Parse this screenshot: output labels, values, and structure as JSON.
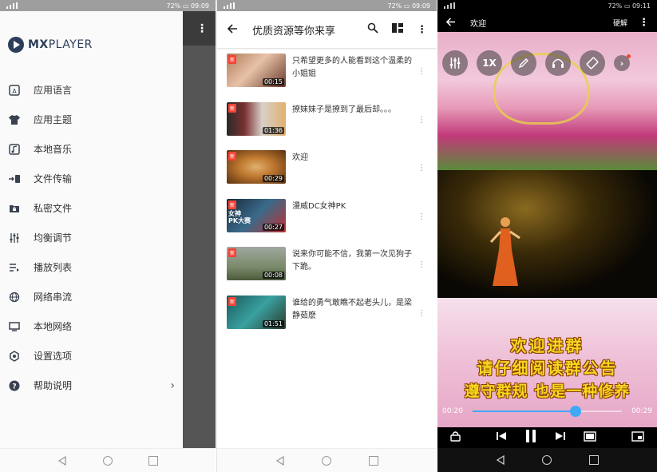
{
  "status": {
    "screen1": {
      "battery": "72%",
      "time": "09:09"
    },
    "screen2": {
      "battery": "72%",
      "time": "09:09"
    },
    "screen3": {
      "battery": "72%",
      "time": "09:11"
    }
  },
  "drawer": {
    "logo_bold": "MX",
    "logo_light": "PLAYER",
    "items": [
      {
        "label": "应用语言",
        "icon": "language-icon"
      },
      {
        "label": "应用主题",
        "icon": "shirt-icon"
      },
      {
        "label": "本地音乐",
        "icon": "music-icon"
      },
      {
        "label": "文件传输",
        "icon": "transfer-icon"
      },
      {
        "label": "私密文件",
        "icon": "lock-folder-icon"
      },
      {
        "label": "均衡调节",
        "icon": "equalizer-icon"
      },
      {
        "label": "播放列表",
        "icon": "playlist-icon"
      },
      {
        "label": "网络串流",
        "icon": "globe-icon"
      },
      {
        "label": "本地网络",
        "icon": "monitor-icon"
      },
      {
        "label": "设置选项",
        "icon": "settings-icon"
      },
      {
        "label": "帮助说明",
        "icon": "help-icon"
      }
    ]
  },
  "list": {
    "title": "优质资源等你来享",
    "new_badge": "新",
    "items": [
      {
        "title": "只希望更多的人能看到这个温柔的小姐姐",
        "duration": "00:15",
        "overlay": ""
      },
      {
        "title": "撩妹妹子是撩到了最后却。。。",
        "duration": "01:36",
        "overlay": ""
      },
      {
        "title": "欢迎",
        "duration": "00:29",
        "overlay": ""
      },
      {
        "title": "漫威DC女神PK",
        "duration": "00:27",
        "overlay": "女神\nPK大赛"
      },
      {
        "title": "说来你可能不信，我第一次见狗子下跪。",
        "duration": "00:08",
        "overlay": ""
      },
      {
        "title": "谁给的勇气敢瞧不起老头儿，是梁静茹麽",
        "duration": "01:51",
        "overlay": ""
      }
    ]
  },
  "player": {
    "title": "欢迎",
    "decoder": "硬解",
    "speed": "1X",
    "current_time": "00:20",
    "total_time": "00:29",
    "progress": 0.69,
    "banner": [
      "欢迎进群",
      "请仔细阅读群公告",
      "遵守群规 也是一种修养"
    ]
  },
  "colors": {
    "accent": "#3fa9f5",
    "badge": "#f44336",
    "logo": "#2c3e59"
  }
}
